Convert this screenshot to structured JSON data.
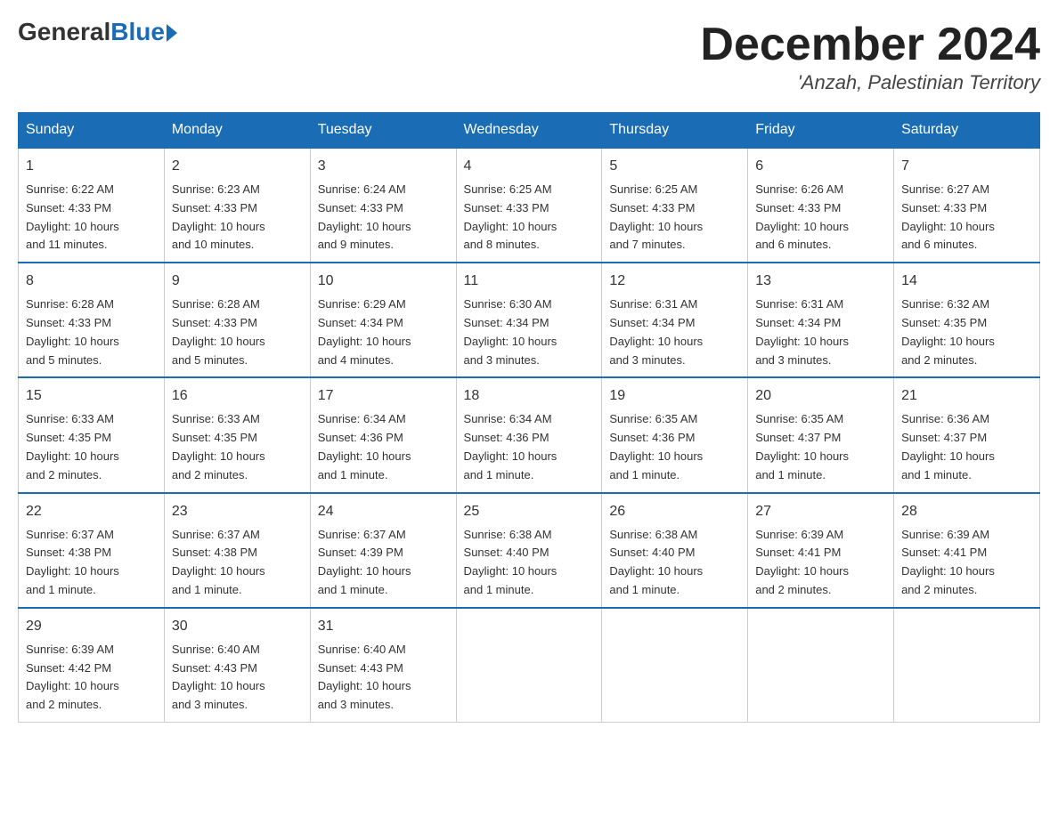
{
  "logo": {
    "general": "General",
    "blue": "Blue"
  },
  "title": {
    "month_year": "December 2024",
    "location": "'Anzah, Palestinian Territory"
  },
  "days_of_week": [
    "Sunday",
    "Monday",
    "Tuesday",
    "Wednesday",
    "Thursday",
    "Friday",
    "Saturday"
  ],
  "weeks": [
    [
      {
        "day": "1",
        "sunrise": "6:22 AM",
        "sunset": "4:33 PM",
        "daylight": "10 hours and 11 minutes."
      },
      {
        "day": "2",
        "sunrise": "6:23 AM",
        "sunset": "4:33 PM",
        "daylight": "10 hours and 10 minutes."
      },
      {
        "day": "3",
        "sunrise": "6:24 AM",
        "sunset": "4:33 PM",
        "daylight": "10 hours and 9 minutes."
      },
      {
        "day": "4",
        "sunrise": "6:25 AM",
        "sunset": "4:33 PM",
        "daylight": "10 hours and 8 minutes."
      },
      {
        "day": "5",
        "sunrise": "6:25 AM",
        "sunset": "4:33 PM",
        "daylight": "10 hours and 7 minutes."
      },
      {
        "day": "6",
        "sunrise": "6:26 AM",
        "sunset": "4:33 PM",
        "daylight": "10 hours and 6 minutes."
      },
      {
        "day": "7",
        "sunrise": "6:27 AM",
        "sunset": "4:33 PM",
        "daylight": "10 hours and 6 minutes."
      }
    ],
    [
      {
        "day": "8",
        "sunrise": "6:28 AM",
        "sunset": "4:33 PM",
        "daylight": "10 hours and 5 minutes."
      },
      {
        "day": "9",
        "sunrise": "6:28 AM",
        "sunset": "4:33 PM",
        "daylight": "10 hours and 5 minutes."
      },
      {
        "day": "10",
        "sunrise": "6:29 AM",
        "sunset": "4:34 PM",
        "daylight": "10 hours and 4 minutes."
      },
      {
        "day": "11",
        "sunrise": "6:30 AM",
        "sunset": "4:34 PM",
        "daylight": "10 hours and 3 minutes."
      },
      {
        "day": "12",
        "sunrise": "6:31 AM",
        "sunset": "4:34 PM",
        "daylight": "10 hours and 3 minutes."
      },
      {
        "day": "13",
        "sunrise": "6:31 AM",
        "sunset": "4:34 PM",
        "daylight": "10 hours and 3 minutes."
      },
      {
        "day": "14",
        "sunrise": "6:32 AM",
        "sunset": "4:35 PM",
        "daylight": "10 hours and 2 minutes."
      }
    ],
    [
      {
        "day": "15",
        "sunrise": "6:33 AM",
        "sunset": "4:35 PM",
        "daylight": "10 hours and 2 minutes."
      },
      {
        "day": "16",
        "sunrise": "6:33 AM",
        "sunset": "4:35 PM",
        "daylight": "10 hours and 2 minutes."
      },
      {
        "day": "17",
        "sunrise": "6:34 AM",
        "sunset": "4:36 PM",
        "daylight": "10 hours and 1 minute."
      },
      {
        "day": "18",
        "sunrise": "6:34 AM",
        "sunset": "4:36 PM",
        "daylight": "10 hours and 1 minute."
      },
      {
        "day": "19",
        "sunrise": "6:35 AM",
        "sunset": "4:36 PM",
        "daylight": "10 hours and 1 minute."
      },
      {
        "day": "20",
        "sunrise": "6:35 AM",
        "sunset": "4:37 PM",
        "daylight": "10 hours and 1 minute."
      },
      {
        "day": "21",
        "sunrise": "6:36 AM",
        "sunset": "4:37 PM",
        "daylight": "10 hours and 1 minute."
      }
    ],
    [
      {
        "day": "22",
        "sunrise": "6:37 AM",
        "sunset": "4:38 PM",
        "daylight": "10 hours and 1 minute."
      },
      {
        "day": "23",
        "sunrise": "6:37 AM",
        "sunset": "4:38 PM",
        "daylight": "10 hours and 1 minute."
      },
      {
        "day": "24",
        "sunrise": "6:37 AM",
        "sunset": "4:39 PM",
        "daylight": "10 hours and 1 minute."
      },
      {
        "day": "25",
        "sunrise": "6:38 AM",
        "sunset": "4:40 PM",
        "daylight": "10 hours and 1 minute."
      },
      {
        "day": "26",
        "sunrise": "6:38 AM",
        "sunset": "4:40 PM",
        "daylight": "10 hours and 1 minute."
      },
      {
        "day": "27",
        "sunrise": "6:39 AM",
        "sunset": "4:41 PM",
        "daylight": "10 hours and 2 minutes."
      },
      {
        "day": "28",
        "sunrise": "6:39 AM",
        "sunset": "4:41 PM",
        "daylight": "10 hours and 2 minutes."
      }
    ],
    [
      {
        "day": "29",
        "sunrise": "6:39 AM",
        "sunset": "4:42 PM",
        "daylight": "10 hours and 2 minutes."
      },
      {
        "day": "30",
        "sunrise": "6:40 AM",
        "sunset": "4:43 PM",
        "daylight": "10 hours and 3 minutes."
      },
      {
        "day": "31",
        "sunrise": "6:40 AM",
        "sunset": "4:43 PM",
        "daylight": "10 hours and 3 minutes."
      },
      null,
      null,
      null,
      null
    ]
  ],
  "labels": {
    "sunrise": "Sunrise:",
    "sunset": "Sunset:",
    "daylight": "Daylight:"
  }
}
